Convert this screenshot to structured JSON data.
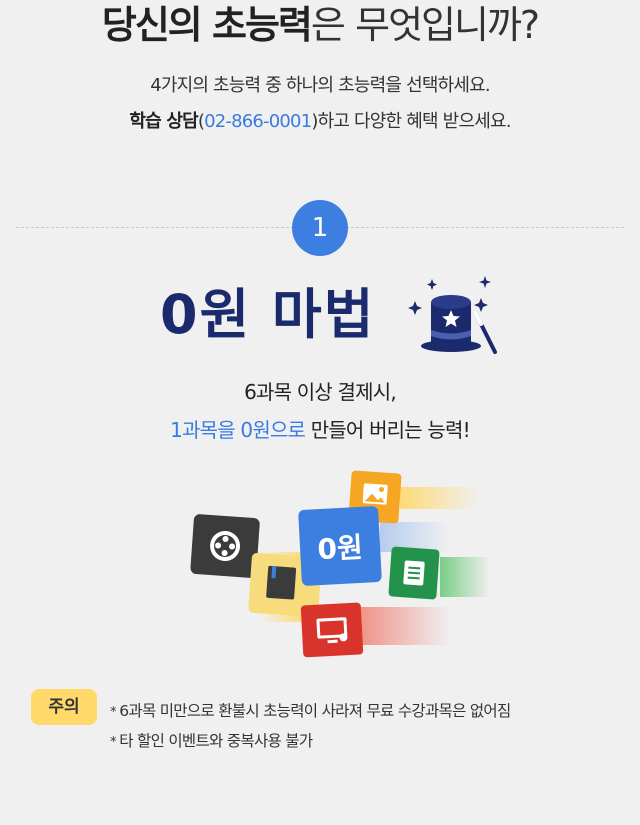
{
  "header": {
    "title_strong_1": "당신의",
    "title_strong_2": "초능력",
    "title_light_1": "은",
    "title_light_2": "무엇입니까?",
    "subtitle": "4가지의 초능력 중 하나의 초능력을 선택하세요.",
    "consult_label": "학습 상담",
    "consult_phone": "02-866-0001",
    "consult_tail": "하고 다양한 혜택 받으세요."
  },
  "power": {
    "number": "1",
    "name": "0원 마법",
    "desc_line1": "6과목 이상 결제시,",
    "desc_highlight": "1과목을 0원으로",
    "desc_tail": "만들어 버리는 능력!",
    "card_label": "0원"
  },
  "colors": {
    "accent_blue": "#3c7fe0",
    "title_navy": "#1a2a6c",
    "badge_yellow": "#ffd96a"
  },
  "icons": [
    "wizard-hat-icon",
    "film-reel-icon",
    "image-icon",
    "book-icon",
    "document-icon",
    "monitor-icon"
  ],
  "notice": {
    "badge": "주의",
    "items": [
      "6과목 미만으로 환불시 초능력이 사라져 무료 수강과목은 없어짐",
      "타 할인 이벤트와 중복사용 불가"
    ]
  }
}
